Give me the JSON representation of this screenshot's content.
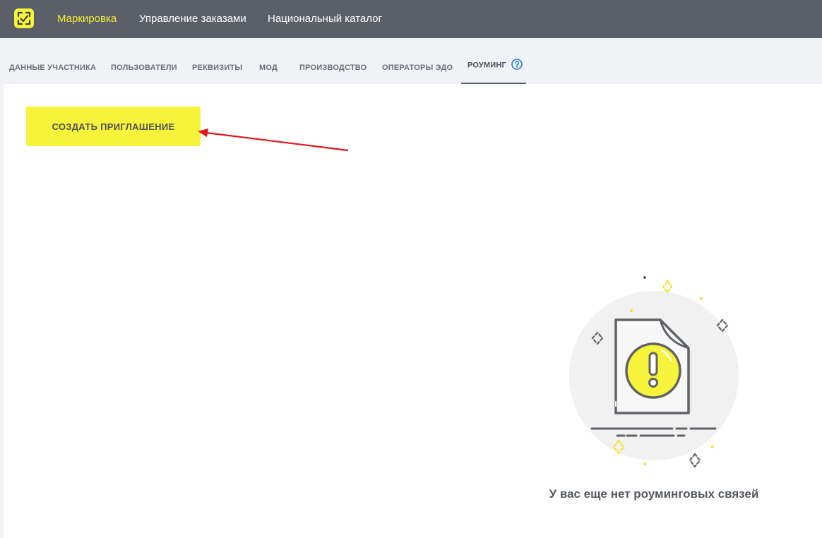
{
  "topbar": {
    "nav": [
      {
        "label": "Маркировка",
        "active": true
      },
      {
        "label": "Управление заказами",
        "active": false
      },
      {
        "label": "Национальный каталог",
        "active": false
      }
    ]
  },
  "tabs": [
    {
      "label": "ДАННЫЕ УЧАСТНИКА"
    },
    {
      "label": "ПОЛЬЗОВАТЕЛИ"
    },
    {
      "label": "РЕКВИЗИТЫ"
    },
    {
      "label": "МОД"
    },
    {
      "label": "ПРОИЗВОДСТВО"
    },
    {
      "label": "ОПЕРАТОРЫ ЭДО"
    },
    {
      "label": "РОУМИНГ",
      "active": true
    }
  ],
  "main": {
    "create_button_label": "СОЗДАТЬ ПРИГЛАШЕНИЕ",
    "empty_state_text": "У вас еще нет роуминговых связей"
  },
  "colors": {
    "topbar": "#5b6068",
    "accent_yellow": "#f6f33a",
    "active_nav": "#f5ee3a",
    "annotation_arrow": "#e0161b",
    "help_icon": "#1e7fd6"
  },
  "icons": [
    "logo-icon",
    "help-icon",
    "empty-document-warning-icon",
    "annotation-arrow"
  ]
}
